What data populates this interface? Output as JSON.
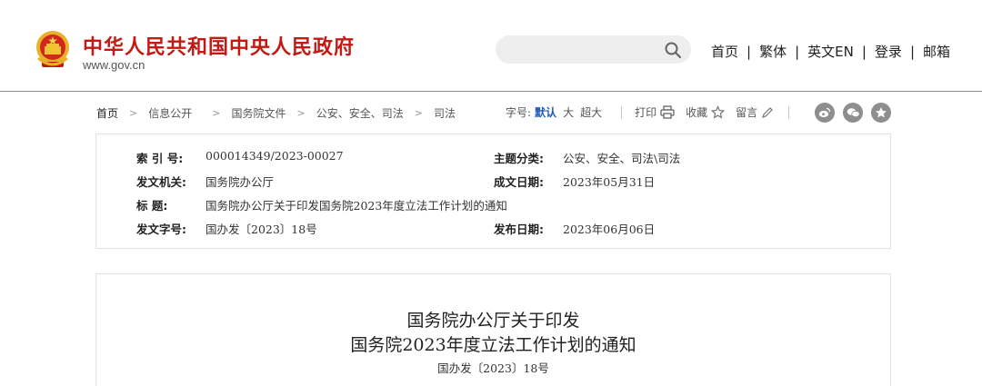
{
  "header": {
    "site_title": "中华人民共和国中央人民政府",
    "site_url": "www.gov.cn",
    "search_placeholder": "",
    "nav": [
      "首页",
      "繁体",
      "英文EN",
      "登录",
      "邮箱"
    ],
    "nav_separator": "|",
    "emblem_icon": "national-emblem-icon",
    "brand_color": "#c41a15"
  },
  "breadcrumb": {
    "items": [
      "首页",
      "信息公开",
      "国务院文件",
      "公安、安全、司法",
      "司法"
    ],
    "separator": ">"
  },
  "toolbar": {
    "font_size_label": "字号:",
    "font_sizes": [
      "默认",
      "大",
      "超大"
    ],
    "active_font_size": "默认",
    "print_label": "打印",
    "favorite_label": "收藏",
    "comment_label": "留言",
    "share_icons": [
      "weibo-icon",
      "wechat-icon",
      "favorite-star-icon"
    ]
  },
  "info": {
    "index_label": "索  引  号:",
    "index_value": "000014349/2023-00027",
    "topic_label": "主题分类:",
    "topic_value": "公安、安全、司法\\司法",
    "issuer_label": "发文机关:",
    "issuer_value": "国务院办公厅",
    "created_label": "成文日期:",
    "created_value": "2023年05月31日",
    "title_label": "标      题:",
    "title_value": "国务院办公厅关于印发国务院2023年度立法工作计划的通知",
    "docno_label": "发文字号:",
    "docno_value": "国办发〔2023〕18号",
    "published_label": "发布日期:",
    "published_value": "2023年06月06日"
  },
  "article": {
    "title_line1": "国务院办公厅关于印发",
    "title_line2": "国务院2023年度立法工作计划的通知",
    "doc_number": "国办发〔2023〕18号"
  }
}
